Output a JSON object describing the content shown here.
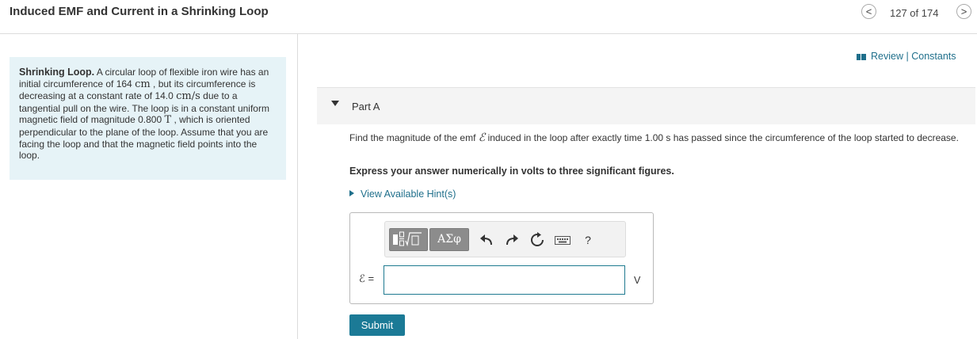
{
  "header": {
    "title": "Induced EMF and Current in a Shrinking Loop",
    "pager": "127 of 174",
    "prev_icon": "<",
    "next_icon": ">"
  },
  "problem": {
    "heading": "Shrinking Loop.",
    "text_1": "A circular loop of flexible iron wire has an initial circumference of 164 ",
    "unit_cm": "cm",
    "text_2": " , but its circumference is decreasing at a constant rate of 14.0 ",
    "unit_cms": "cm/s",
    "text_3": " due to a tangential pull on the wire. The loop is in a constant uniform magnetic field of magnitude 0.800 ",
    "unit_T": "T",
    "text_4": " , which is oriented perpendicular to the plane of the loop. Assume that you are facing the loop and that the magnetic field points into the loop."
  },
  "review": {
    "review_label": "Review",
    "separator": "|",
    "constants_label": "Constants",
    "icon": "book-icon"
  },
  "part": {
    "label": "Part A"
  },
  "question": {
    "text_1": "Find the magnitude of the emf ",
    "symbol": "ℰ",
    "text_2": " induced in the loop after exactly time 1.00 s has passed since the circumference of the loop started to decrease."
  },
  "instruction": "Express your answer numerically in volts to three significant figures.",
  "hint": "View Available Hint(s)",
  "answer": {
    "greek_label": "ΑΣφ",
    "help_label": "?",
    "eq_label": "ℰ =",
    "value": "",
    "unit": "V"
  },
  "submit_label": "Submit",
  "colors": {
    "accent": "#1f6f8b",
    "submit_bg": "#1b7a96",
    "problem_bg": "#e6f3f7"
  }
}
